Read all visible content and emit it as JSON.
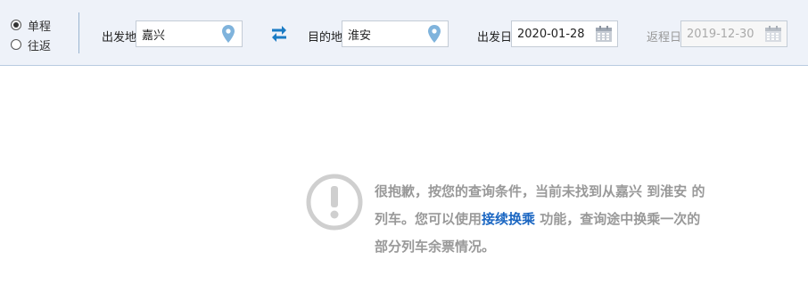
{
  "trip_type": {
    "options": [
      "单程",
      "往返"
    ],
    "selected": "单程"
  },
  "from": {
    "label": "出发地",
    "value": "嘉兴"
  },
  "to": {
    "label": "目的地",
    "value": "淮安"
  },
  "depart_date": {
    "label": "出发日",
    "value": "2020-01-28"
  },
  "return_date": {
    "label": "返程日",
    "value": "2019-12-30"
  },
  "icons": {
    "location": "location-pin-icon",
    "swap": "swap-arrows-icon",
    "calendar": "calendar-icon",
    "notice": "exclamation-circle-icon"
  },
  "colors": {
    "accent": "#1a66c2",
    "pin": "#7fb3dc",
    "notice_gray": "#999999",
    "bar_bg": "#eef2f9"
  },
  "notice": {
    "line1": "很抱歉，按您的查询条件，当前未找到从嘉兴 到淮安 的",
    "line2_prefix": "列车。您可以使用",
    "link": "接续换乘",
    "line2_suffix": " 功能，查询途中换乘一次的",
    "line3": "部分列车余票情况。"
  }
}
